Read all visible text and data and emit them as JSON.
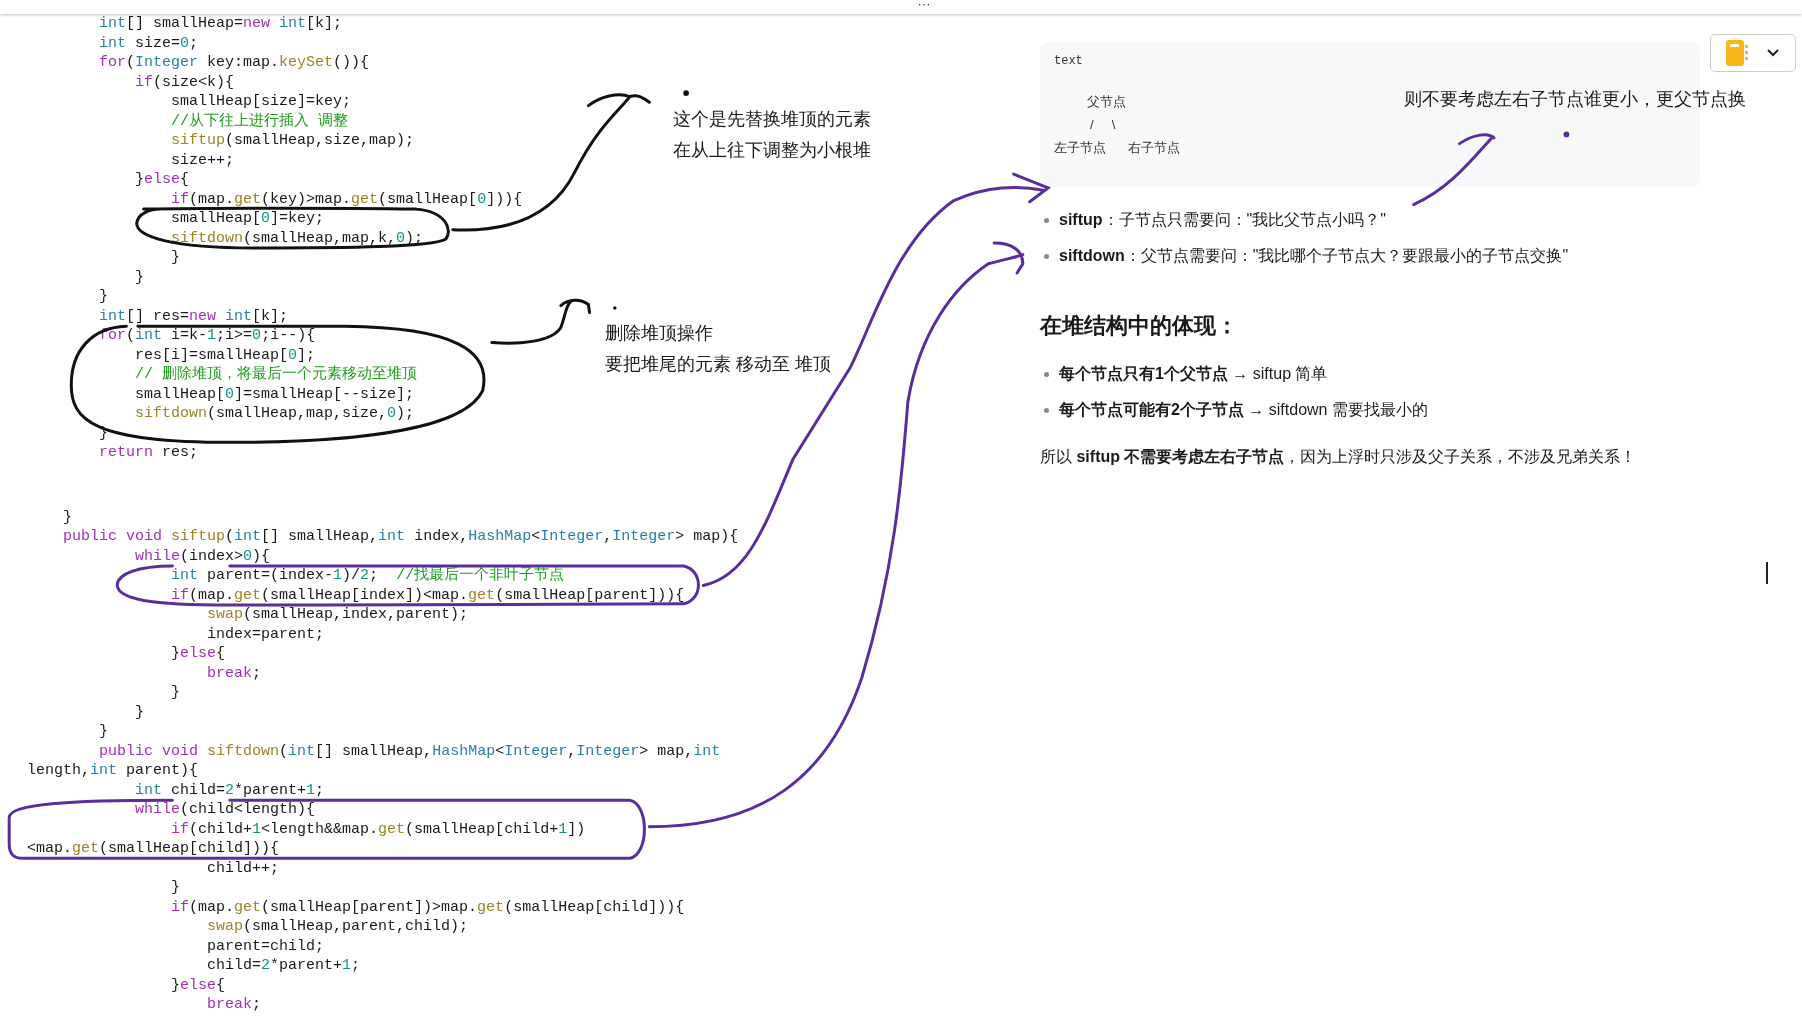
{
  "top_bar": {
    "menu": "···"
  },
  "code": {
    "sections": [
      {
        "lines": [
          {
            "tokens": [
              {
                "kind": "type",
                "text": "        int"
              },
              {
                "kind": "txt",
                "text": "[] smallHeap="
              },
              {
                "kind": "kw",
                "text": "new"
              },
              {
                "kind": "type",
                "text": " int"
              },
              {
                "kind": "txt",
                "text": "[k];"
              }
            ]
          },
          {
            "tokens": [
              {
                "kind": "type",
                "text": "        int"
              },
              {
                "kind": "txt",
                "text": " size="
              },
              {
                "kind": "num",
                "text": "0"
              },
              {
                "kind": "txt",
                "text": ";"
              }
            ]
          },
          {
            "tokens": [
              {
                "kind": "kw",
                "text": "        for"
              },
              {
                "kind": "txt",
                "text": "("
              },
              {
                "kind": "type",
                "text": "Integer"
              },
              {
                "kind": "txt",
                "text": " key:map."
              },
              {
                "kind": "fn",
                "text": "keySet"
              },
              {
                "kind": "txt",
                "text": "()){"
              }
            ]
          },
          {
            "tokens": [
              {
                "kind": "kw",
                "text": "            if"
              },
              {
                "kind": "txt",
                "text": "(size<k){"
              }
            ]
          },
          {
            "tokens": [
              {
                "kind": "txt",
                "text": "                smallHeap[size]=key;"
              }
            ]
          },
          {
            "tokens": [
              {
                "kind": "cmt",
                "text": "                //从下往上进行插入 调整"
              }
            ]
          },
          {
            "tokens": [
              {
                "kind": "fn",
                "text": "                siftup"
              },
              {
                "kind": "txt",
                "text": "(smallHeap,size,map);"
              }
            ]
          },
          {
            "tokens": [
              {
                "kind": "txt",
                "text": "                size++;"
              }
            ]
          },
          {
            "tokens": [
              {
                "kind": "txt",
                "text": "            }"
              },
              {
                "kind": "kw",
                "text": "else"
              },
              {
                "kind": "txt",
                "text": "{"
              }
            ]
          },
          {
            "tokens": [
              {
                "kind": "kw",
                "text": "                if"
              },
              {
                "kind": "txt",
                "text": "(map."
              },
              {
                "kind": "fn",
                "text": "get"
              },
              {
                "kind": "txt",
                "text": "(key)>map."
              },
              {
                "kind": "fn",
                "text": "get"
              },
              {
                "kind": "txt",
                "text": "(smallHeap["
              },
              {
                "kind": "num",
                "text": "0"
              },
              {
                "kind": "txt",
                "text": "])){"
              }
            ]
          },
          {
            "tokens": [
              {
                "kind": "txt",
                "text": "                smallHeap["
              },
              {
                "kind": "num",
                "text": "0"
              },
              {
                "kind": "txt",
                "text": "]=key;"
              }
            ]
          },
          {
            "tokens": [
              {
                "kind": "fn",
                "text": "                siftdown"
              },
              {
                "kind": "txt",
                "text": "(smallHeap,map,k,"
              },
              {
                "kind": "num",
                "text": "0"
              },
              {
                "kind": "txt",
                "text": ");"
              }
            ]
          },
          {
            "tokens": [
              {
                "kind": "txt",
                "text": "                }"
              }
            ]
          },
          {
            "tokens": [
              {
                "kind": "txt",
                "text": "            }"
              }
            ]
          },
          {
            "tokens": [
              {
                "kind": "txt",
                "text": "        }"
              }
            ]
          },
          {
            "tokens": [
              {
                "kind": "type",
                "text": "        int"
              },
              {
                "kind": "txt",
                "text": "[] res="
              },
              {
                "kind": "kw",
                "text": "new"
              },
              {
                "kind": "type",
                "text": " int"
              },
              {
                "kind": "txt",
                "text": "[k];"
              }
            ]
          },
          {
            "tokens": [
              {
                "kind": "kw",
                "text": "        for"
              },
              {
                "kind": "txt",
                "text": "("
              },
              {
                "kind": "type",
                "text": "int"
              },
              {
                "kind": "txt",
                "text": " i=k-"
              },
              {
                "kind": "num",
                "text": "1"
              },
              {
                "kind": "txt",
                "text": ";i>="
              },
              {
                "kind": "num",
                "text": "0"
              },
              {
                "kind": "txt",
                "text": ";i--){"
              }
            ]
          },
          {
            "tokens": [
              {
                "kind": "txt",
                "text": "            res[i]=smallHeap["
              },
              {
                "kind": "num",
                "text": "0"
              },
              {
                "kind": "txt",
                "text": "];"
              }
            ]
          },
          {
            "tokens": [
              {
                "kind": "cmt",
                "text": "            // 删除堆顶，将最后一个元素移动至堆顶"
              }
            ]
          },
          {
            "tokens": [
              {
                "kind": "txt",
                "text": "            smallHeap["
              },
              {
                "kind": "num",
                "text": "0"
              },
              {
                "kind": "txt",
                "text": "]=smallHeap[--size];"
              }
            ]
          },
          {
            "tokens": [
              {
                "kind": "fn",
                "text": "            siftdown"
              },
              {
                "kind": "txt",
                "text": "(smallHeap,map,size,"
              },
              {
                "kind": "num",
                "text": "0"
              },
              {
                "kind": "txt",
                "text": ");"
              }
            ]
          },
          {
            "tokens": [
              {
                "kind": "txt",
                "text": "        }"
              }
            ]
          },
          {
            "tokens": [
              {
                "kind": "kw",
                "text": "        return"
              },
              {
                "kind": "txt",
                "text": " res;"
              }
            ]
          }
        ]
      },
      {
        "lines": [
          {
            "tokens": [
              {
                "kind": "txt",
                "text": "    }"
              }
            ]
          },
          {
            "tokens": [
              {
                "kind": "kw",
                "text": "    public"
              },
              {
                "kind": "kw",
                "text": " void"
              },
              {
                "kind": "fn",
                "text": " siftup"
              },
              {
                "kind": "txt",
                "text": "("
              },
              {
                "kind": "type",
                "text": "int"
              },
              {
                "kind": "txt",
                "text": "[] smallHeap,"
              },
              {
                "kind": "type",
                "text": "int"
              },
              {
                "kind": "txt",
                "text": " index,"
              },
              {
                "kind": "type",
                "text": "HashMap"
              },
              {
                "kind": "txt",
                "text": "<"
              },
              {
                "kind": "type",
                "text": "Integer"
              },
              {
                "kind": "txt",
                "text": ","
              },
              {
                "kind": "type",
                "text": "Integer"
              },
              {
                "kind": "txt",
                "text": "> map){"
              }
            ]
          },
          {
            "tokens": [
              {
                "kind": "kw",
                "text": "            while"
              },
              {
                "kind": "txt",
                "text": "(index>"
              },
              {
                "kind": "num",
                "text": "0"
              },
              {
                "kind": "txt",
                "text": "){"
              }
            ]
          },
          {
            "tokens": [
              {
                "kind": "type",
                "text": "                int"
              },
              {
                "kind": "txt",
                "text": " parent=(index-"
              },
              {
                "kind": "num",
                "text": "1"
              },
              {
                "kind": "txt",
                "text": ")/"
              },
              {
                "kind": "num",
                "text": "2"
              },
              {
                "kind": "txt",
                "text": ";  "
              },
              {
                "kind": "cmt",
                "text": "//找最后一个非叶子节点"
              }
            ]
          },
          {
            "tokens": [
              {
                "kind": "kw",
                "text": "                if"
              },
              {
                "kind": "txt",
                "text": "(map."
              },
              {
                "kind": "fn",
                "text": "get"
              },
              {
                "kind": "txt",
                "text": "(smallHeap[index])<map."
              },
              {
                "kind": "fn",
                "text": "get"
              },
              {
                "kind": "txt",
                "text": "(smallHeap[parent])){"
              }
            ]
          },
          {
            "tokens": [
              {
                "kind": "fn",
                "text": "                    swap"
              },
              {
                "kind": "txt",
                "text": "(smallHeap,index,parent);"
              }
            ]
          },
          {
            "tokens": [
              {
                "kind": "txt",
                "text": "                    index=parent;"
              }
            ]
          },
          {
            "tokens": [
              {
                "kind": "txt",
                "text": "                }"
              },
              {
                "kind": "kw",
                "text": "else"
              },
              {
                "kind": "txt",
                "text": "{"
              }
            ]
          },
          {
            "tokens": [
              {
                "kind": "kw",
                "text": "                    break"
              },
              {
                "kind": "txt",
                "text": ";"
              }
            ]
          },
          {
            "tokens": [
              {
                "kind": "txt",
                "text": "                }"
              }
            ]
          },
          {
            "tokens": [
              {
                "kind": "txt",
                "text": "            }"
              }
            ]
          },
          {
            "tokens": [
              {
                "kind": "txt",
                "text": "        }"
              }
            ]
          },
          {
            "tokens": [
              {
                "kind": "kw",
                "text": "        public"
              },
              {
                "kind": "kw",
                "text": " void"
              },
              {
                "kind": "fn",
                "text": " siftdown"
              },
              {
                "kind": "txt",
                "text": "("
              },
              {
                "kind": "type",
                "text": "int"
              },
              {
                "kind": "txt",
                "text": "[] smallHeap,"
              },
              {
                "kind": "type",
                "text": "HashMap"
              },
              {
                "kind": "txt",
                "text": "<"
              },
              {
                "kind": "type",
                "text": "Integer"
              },
              {
                "kind": "txt",
                "text": ","
              },
              {
                "kind": "type",
                "text": "Integer"
              },
              {
                "kind": "txt",
                "text": "> map,"
              },
              {
                "kind": "type",
                "text": "int"
              }
            ]
          },
          {
            "tokens": [
              {
                "kind": "txt",
                "text": "length,"
              },
              {
                "kind": "type",
                "text": "int"
              },
              {
                "kind": "txt",
                "text": " parent){"
              }
            ]
          },
          {
            "tokens": [
              {
                "kind": "type",
                "text": "            int"
              },
              {
                "kind": "txt",
                "text": " child="
              },
              {
                "kind": "num",
                "text": "2"
              },
              {
                "kind": "txt",
                "text": "*parent+"
              },
              {
                "kind": "num",
                "text": "1"
              },
              {
                "kind": "txt",
                "text": ";"
              }
            ]
          },
          {
            "tokens": [
              {
                "kind": "kw",
                "text": "            while"
              },
              {
                "kind": "txt",
                "text": "(child<length){"
              }
            ]
          },
          {
            "tokens": [
              {
                "kind": "kw",
                "text": "                if"
              },
              {
                "kind": "txt",
                "text": "(child+"
              },
              {
                "kind": "num",
                "text": "1"
              },
              {
                "kind": "txt",
                "text": "<length&&map."
              },
              {
                "kind": "fn",
                "text": "get"
              },
              {
                "kind": "txt",
                "text": "(smallHeap[child+"
              },
              {
                "kind": "num",
                "text": "1"
              },
              {
                "kind": "txt",
                "text": "])"
              }
            ]
          },
          {
            "tokens": [
              {
                "kind": "txt",
                "text": "<map."
              },
              {
                "kind": "fn",
                "text": "get"
              },
              {
                "kind": "txt",
                "text": "(smallHeap[child])){"
              }
            ]
          },
          {
            "tokens": [
              {
                "kind": "txt",
                "text": "                    child++;"
              }
            ]
          },
          {
            "tokens": [
              {
                "kind": "txt",
                "text": "                }"
              }
            ]
          },
          {
            "tokens": [
              {
                "kind": "kw",
                "text": "                if"
              },
              {
                "kind": "txt",
                "text": "(map."
              },
              {
                "kind": "fn",
                "text": "get"
              },
              {
                "kind": "txt",
                "text": "(smallHeap[parent])>map."
              },
              {
                "kind": "fn",
                "text": "get"
              },
              {
                "kind": "txt",
                "text": "(smallHeap[child])){"
              }
            ]
          },
          {
            "tokens": [
              {
                "kind": "fn",
                "text": "                    swap"
              },
              {
                "kind": "txt",
                "text": "(smallHeap,parent,child);"
              }
            ]
          },
          {
            "tokens": [
              {
                "kind": "txt",
                "text": "                    parent=child;"
              }
            ]
          },
          {
            "tokens": [
              {
                "kind": "txt",
                "text": "                    child="
              },
              {
                "kind": "num",
                "text": "2"
              },
              {
                "kind": "txt",
                "text": "*parent+"
              },
              {
                "kind": "num",
                "text": "1"
              },
              {
                "kind": "txt",
                "text": ";"
              }
            ]
          },
          {
            "tokens": [
              {
                "kind": "txt",
                "text": "                }"
              },
              {
                "kind": "kw",
                "text": "else"
              },
              {
                "kind": "txt",
                "text": "{"
              }
            ]
          },
          {
            "tokens": [
              {
                "kind": "kw",
                "text": "                    break"
              },
              {
                "kind": "txt",
                "text": ";"
              }
            ]
          }
        ]
      }
    ]
  },
  "note": {
    "code_block": {
      "language": "text",
      "lines": [
        "         父节点",
        "          /     \\",
        "左子节点      右子节点"
      ]
    },
    "bullets": [
      "**siftup**：子节点只需要问：\"我比父节点小吗？\"",
      "**siftdown**：父节点需要问：\"我比哪个子节点大？要跟最小的子节点交换\""
    ],
    "heading": "在堆结构中的体现：",
    "bullets_2": [
      "**每个节点只有1个父节点** → siftup 简单",
      "**每个节点可能有2个子节点** → siftdown 需要找最小的"
    ],
    "paragraph": "所以 **siftup 不需要考虑左右子节点**，因为上浮时只涉及父子关系，不涉及兄弟关系！"
  },
  "annotations": [
    {
      "lines": [
        "这个是先替换堆顶的元素",
        "在从上往下调整为小根堆"
      ]
    },
    {
      "lines": [
        "删除堆顶操作",
        "要把堆尾的元素 移动至 堆顶"
      ]
    },
    {
      "lines": [
        "则不要考虑左右子节点谁更小，更父节点换"
      ]
    }
  ]
}
